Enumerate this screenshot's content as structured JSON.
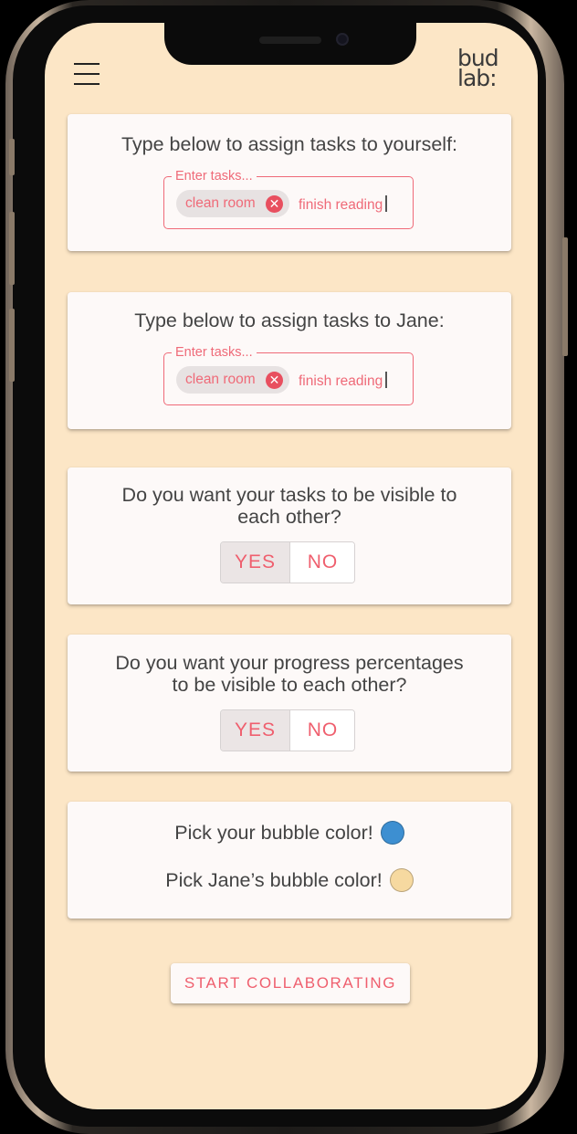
{
  "header": {
    "menu_icon": "hamburger-menu-icon",
    "logo_lines": [
      "bud",
      "lab:"
    ]
  },
  "self_tasks": {
    "title": "Type below to assign tasks to yourself:",
    "field_label": "Enter tasks...",
    "chip_label": "clean room",
    "typed_value": "finish reading"
  },
  "partner_tasks": {
    "title": "Type below to assign tasks to Jane:",
    "field_label": "Enter tasks...",
    "chip_label": "clean room",
    "typed_value": "finish reading"
  },
  "task_visibility": {
    "title_line1": "Do you want your tasks to be visible to",
    "title_line2": "each other?",
    "yes_label": "YES",
    "no_label": "NO",
    "selected": "YES"
  },
  "progress_visibility": {
    "title_line1": "Do you want your progress percentages",
    "title_line2": "to be visible to each other?",
    "yes_label": "YES",
    "no_label": "NO",
    "selected": "YES"
  },
  "bubble_colors": {
    "self_label": "Pick your bubble color!",
    "self_color": "#3d8fd1",
    "partner_label": "Pick Jane’s bubble color!",
    "partner_color": "#f6d9a0"
  },
  "start_button": "START COLLABORATING",
  "colors": {
    "accent": "#ef5f6e",
    "background": "#fce6c6",
    "card": "#fdf9f8"
  }
}
